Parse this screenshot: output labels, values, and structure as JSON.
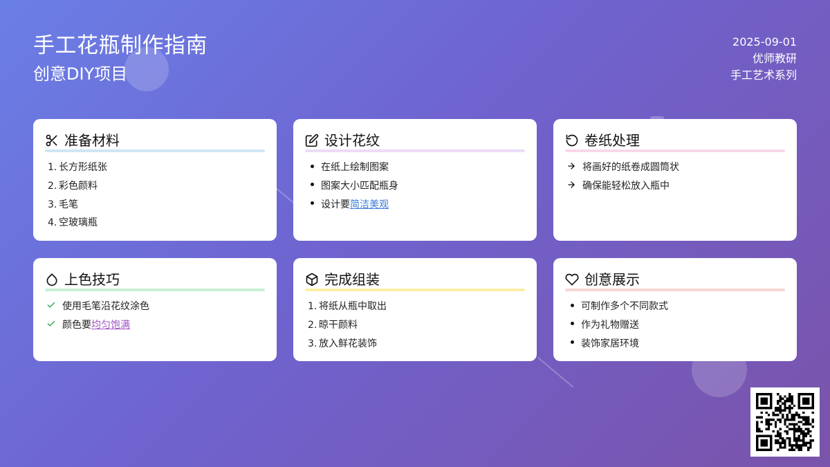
{
  "header": {
    "title": "手工花瓶制作指南",
    "subtitle": "创意DIY项目"
  },
  "meta": {
    "date": "2025-09-01",
    "author": "优师教研",
    "series": "手工艺术系列"
  },
  "cards": [
    {
      "title": "准备材料",
      "icon": "scissors-icon",
      "accent": "#cfe6f4",
      "list_style": "numbered",
      "items": [
        "长方形纸张",
        "彩色颜料",
        "毛笔",
        "空玻璃瓶"
      ]
    },
    {
      "title": "设计花纹",
      "icon": "edit-icon",
      "accent": "#ecdcf6",
      "list_style": "bullet",
      "items": [
        "在纸上绘制图案",
        "图案大小匹配瓶身"
      ],
      "last_item_prefix": "设计要",
      "last_item_link": "简洁美观"
    },
    {
      "title": "卷纸处理",
      "icon": "rotate-icon",
      "accent": "#f9d7e9",
      "list_style": "arrow",
      "items": [
        "将画好的纸卷成圆筒状",
        "确保能轻松放入瓶中"
      ]
    },
    {
      "title": "上色技巧",
      "icon": "droplet-icon",
      "accent": "#c9f0d4",
      "list_style": "check",
      "items": [
        "使用毛笔沿花纹涂色"
      ],
      "last_item_prefix": "颜色要",
      "last_item_link": "均匀饱满"
    },
    {
      "title": "完成组装",
      "icon": "box-icon",
      "accent": "#fbefa6",
      "list_style": "numbered",
      "items": [
        "将纸从瓶中取出",
        "晾干颜料",
        "放入鲜花装饰"
      ]
    },
    {
      "title": "创意展示",
      "icon": "heart-icon",
      "accent": "#f7d6d6",
      "list_style": "bullet",
      "items": [
        "可制作多个不同款式",
        "作为礼物赠送",
        "装饰家居环境"
      ]
    }
  ],
  "qr": {
    "icon": "qr-code-icon"
  }
}
